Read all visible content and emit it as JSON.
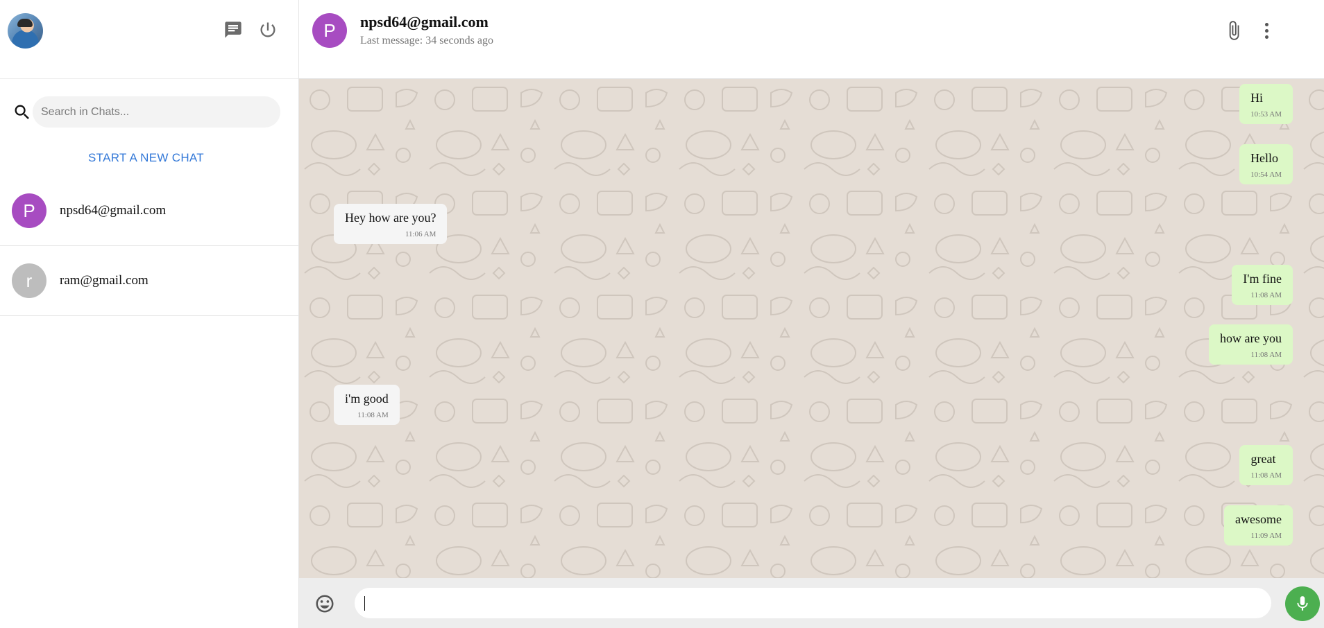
{
  "sidebar": {
    "search": {
      "placeholder": "Search in Chats..."
    },
    "new_chat_label": "START A NEW CHAT",
    "chats": [
      {
        "initial": "P",
        "name": "npsd64@gmail.com",
        "color": "#a74cc1"
      },
      {
        "initial": "r",
        "name": "ram@gmail.com",
        "color": "#bdbdbd"
      }
    ]
  },
  "header": {
    "initial": "P",
    "title": "npsd64@gmail.com",
    "status": "Last message: 34 seconds ago",
    "avatar_color": "#a74cc1"
  },
  "messages": [
    {
      "dir": "out",
      "text": "Hi",
      "time": "10:53 AM"
    },
    {
      "dir": "out",
      "text": "Hello",
      "time": "10:54 AM"
    },
    {
      "dir": "in",
      "text": "Hey how are you?",
      "time": "11:06 AM"
    },
    {
      "dir": "out",
      "text": "I'm fine",
      "time": "11:08 AM"
    },
    {
      "dir": "out",
      "text": "how are you",
      "time": "11:08 AM"
    },
    {
      "dir": "in",
      "text": "i'm good",
      "time": "11:08 AM"
    },
    {
      "dir": "out",
      "text": "great",
      "time": "11:08 AM"
    },
    {
      "dir": "out",
      "text": "awesome",
      "time": "11:09 AM"
    }
  ],
  "composer": {
    "value": ""
  },
  "colors": {
    "outgoing_bubble": "#dcf8c6",
    "incoming_bubble": "#f5f5f5",
    "chat_background": "#e5ddd5",
    "link_blue": "#3479d8",
    "mic_green": "#4caf50"
  },
  "icons": [
    "chat-icon",
    "power-icon",
    "search-icon",
    "attach-icon",
    "more-vert-icon",
    "emoji-icon",
    "mic-icon"
  ]
}
